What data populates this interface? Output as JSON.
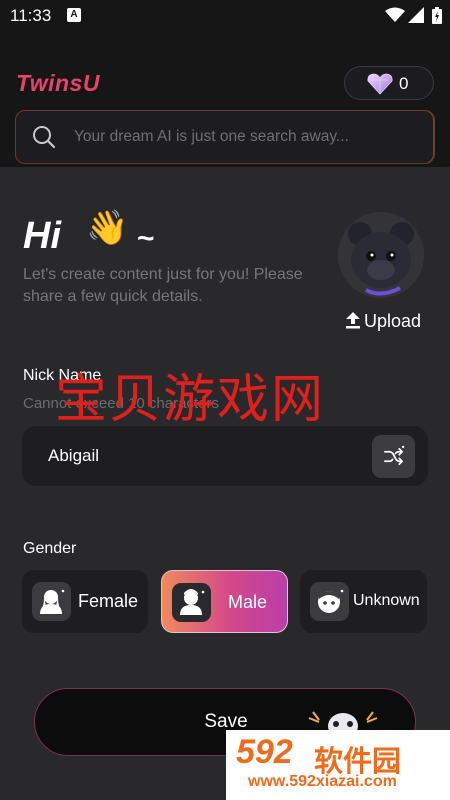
{
  "status_bar": {
    "time": "11:33",
    "notif_icon_letter": "A"
  },
  "header": {
    "app_name": "TwinsU",
    "coin_count": "0"
  },
  "search": {
    "placeholder": "Your dream AI is just one search away..."
  },
  "greeting": {
    "hi": "Hi",
    "tilde": "~",
    "intro": "Let's create content just for you! Please share a few quick details."
  },
  "avatar": {
    "upload_label": "Upload"
  },
  "nick": {
    "label": "Nick Name",
    "hint": "Cannot exceed 10 characters",
    "value": "Abigail"
  },
  "gender": {
    "label": "Gender",
    "options": [
      {
        "label": "Female",
        "selected": false
      },
      {
        "label": "Male",
        "selected": true
      },
      {
        "label": "Unknown",
        "selected": false
      }
    ]
  },
  "save": {
    "label": "Save"
  },
  "watermark": {
    "cn_text": "宝贝游戏网",
    "site_num": "592",
    "site_cn": "软件园",
    "site_url": "www.592xiazai.com"
  },
  "colors": {
    "accent_pink": "#e8426b",
    "background": "#29292b",
    "header_bg": "#161617"
  }
}
